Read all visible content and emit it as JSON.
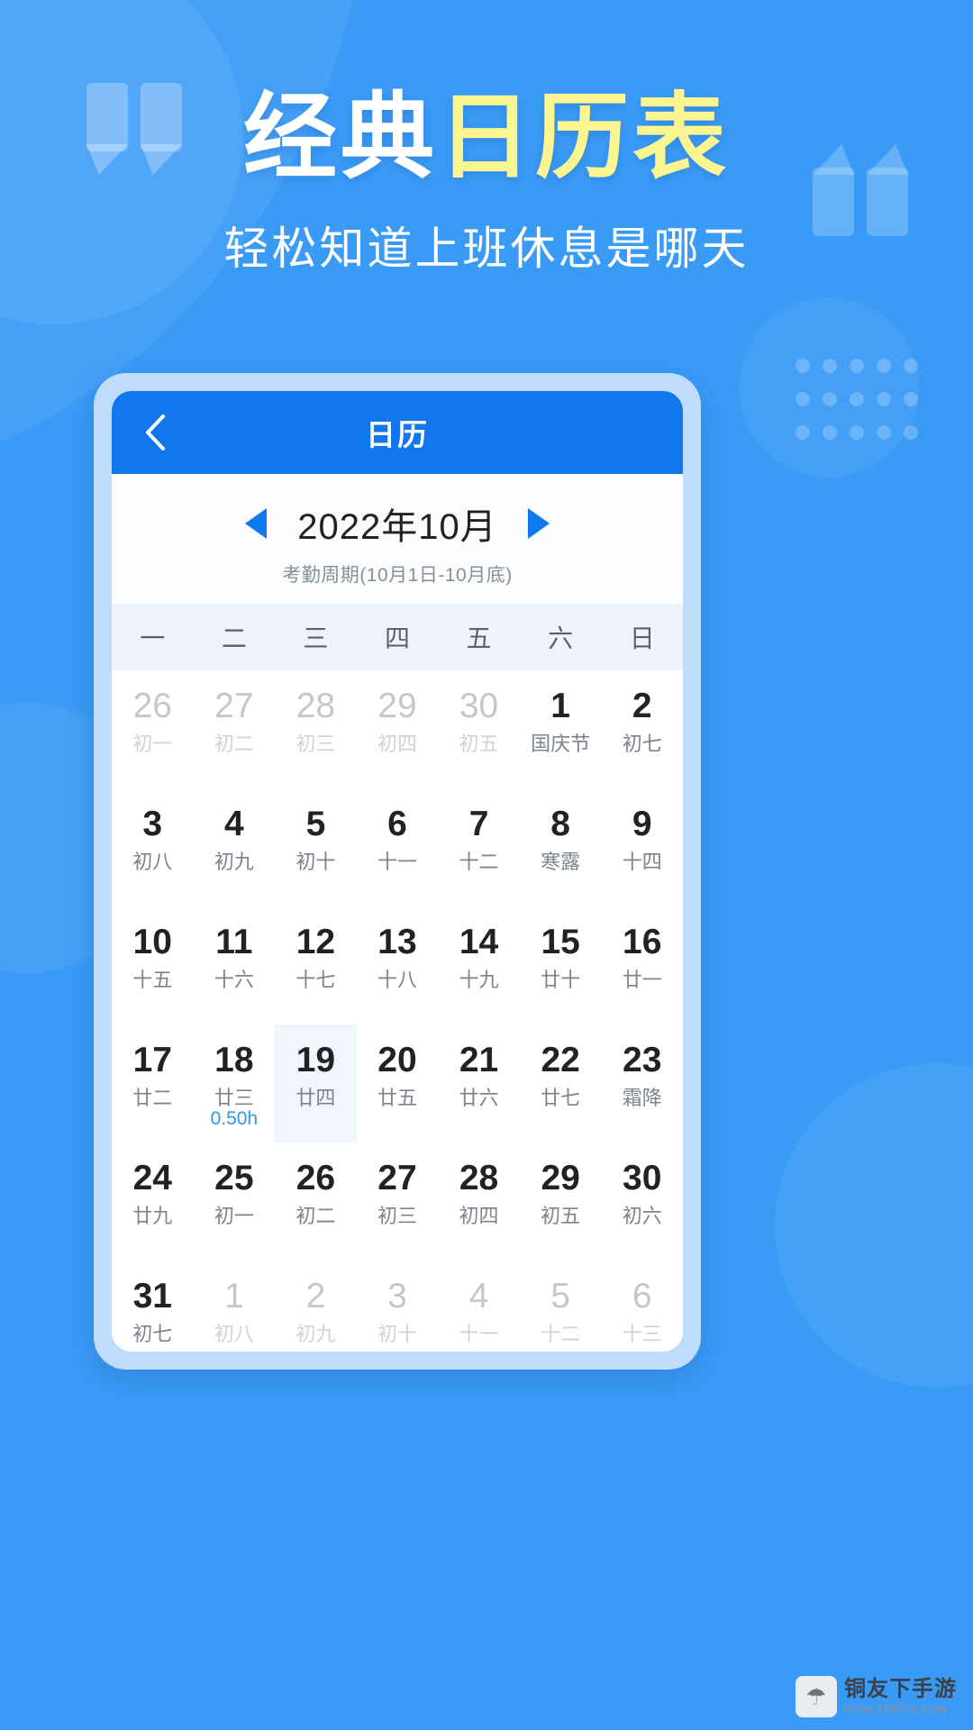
{
  "promo": {
    "title_white": "经典",
    "title_yellow": "日历表",
    "subtitle": "轻松知道上班休息是哪天",
    "accent_blue": "#3a9bf7",
    "accent_yellow": "#fdf58f"
  },
  "app": {
    "header": {
      "back_icon": "chevron-left-icon",
      "title": "日历",
      "bar_color": "#1177ee"
    },
    "month_nav": {
      "prev_icon": "triangle-left-icon",
      "next_icon": "triangle-right-icon",
      "month_label": "2022年10月",
      "cycle_label": "考勤周期(10月1日-10月底)"
    },
    "weekdays": [
      "一",
      "二",
      "三",
      "四",
      "五",
      "六",
      "日"
    ],
    "days": [
      {
        "num": "26",
        "lunar": "初一",
        "muted": true
      },
      {
        "num": "27",
        "lunar": "初二",
        "muted": true
      },
      {
        "num": "28",
        "lunar": "初三",
        "muted": true
      },
      {
        "num": "29",
        "lunar": "初四",
        "muted": true
      },
      {
        "num": "30",
        "lunar": "初五",
        "muted": true
      },
      {
        "num": "1",
        "lunar": "国庆节",
        "muted": false
      },
      {
        "num": "2",
        "lunar": "初七",
        "muted": false
      },
      {
        "num": "3",
        "lunar": "初八",
        "muted": false
      },
      {
        "num": "4",
        "lunar": "初九",
        "muted": false
      },
      {
        "num": "5",
        "lunar": "初十",
        "muted": false
      },
      {
        "num": "6",
        "lunar": "十一",
        "muted": false
      },
      {
        "num": "7",
        "lunar": "十二",
        "muted": false
      },
      {
        "num": "8",
        "lunar": "寒露",
        "muted": false
      },
      {
        "num": "9",
        "lunar": "十四",
        "muted": false
      },
      {
        "num": "10",
        "lunar": "十五",
        "muted": false
      },
      {
        "num": "11",
        "lunar": "十六",
        "muted": false
      },
      {
        "num": "12",
        "lunar": "十七",
        "muted": false
      },
      {
        "num": "13",
        "lunar": "十八",
        "muted": false
      },
      {
        "num": "14",
        "lunar": "十九",
        "muted": false
      },
      {
        "num": "15",
        "lunar": "廿十",
        "muted": false
      },
      {
        "num": "16",
        "lunar": "廿一",
        "muted": false
      },
      {
        "num": "17",
        "lunar": "廿二",
        "muted": false
      },
      {
        "num": "18",
        "lunar": "廿三",
        "muted": false,
        "hours": "0.50h"
      },
      {
        "num": "19",
        "lunar": "廿四",
        "muted": false,
        "selected": true
      },
      {
        "num": "20",
        "lunar": "廿五",
        "muted": false
      },
      {
        "num": "21",
        "lunar": "廿六",
        "muted": false
      },
      {
        "num": "22",
        "lunar": "廿七",
        "muted": false
      },
      {
        "num": "23",
        "lunar": "霜降",
        "muted": false
      },
      {
        "num": "24",
        "lunar": "廿九",
        "muted": false
      },
      {
        "num": "25",
        "lunar": "初一",
        "muted": false
      },
      {
        "num": "26",
        "lunar": "初二",
        "muted": false
      },
      {
        "num": "27",
        "lunar": "初三",
        "muted": false
      },
      {
        "num": "28",
        "lunar": "初四",
        "muted": false
      },
      {
        "num": "29",
        "lunar": "初五",
        "muted": false
      },
      {
        "num": "30",
        "lunar": "初六",
        "muted": false
      },
      {
        "num": "31",
        "lunar": "初七",
        "muted": false
      },
      {
        "num": "1",
        "lunar": "初八",
        "muted": true
      },
      {
        "num": "2",
        "lunar": "初九",
        "muted": true
      },
      {
        "num": "3",
        "lunar": "初十",
        "muted": true
      },
      {
        "num": "4",
        "lunar": "十一",
        "muted": true
      },
      {
        "num": "5",
        "lunar": "十二",
        "muted": true
      },
      {
        "num": "6",
        "lunar": "十三",
        "muted": true
      }
    ]
  },
  "watermark": {
    "icon": "site-logo-icon",
    "main": "铜友下手游",
    "sub": "www.1686t0.com"
  }
}
